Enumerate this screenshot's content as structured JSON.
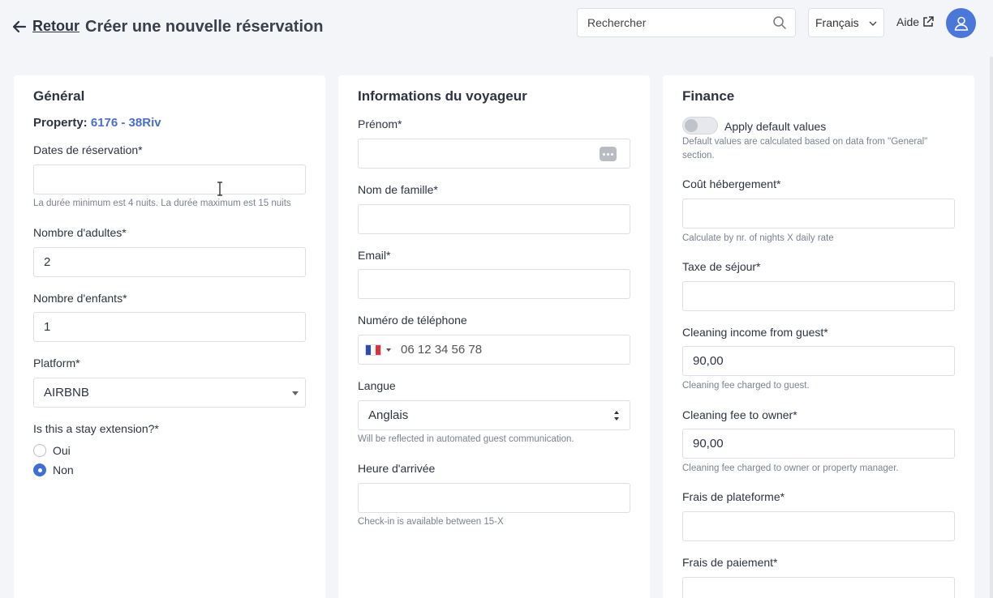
{
  "header": {
    "back_label": "Retour",
    "title": "Créer une nouvelle réservation",
    "search_placeholder": "Rechercher",
    "language": "Français",
    "help_label": "Aide"
  },
  "general": {
    "title": "Général",
    "property_key": "Property:",
    "property_value": "6176 - 38Riv",
    "dates_label": "Dates de réservation*",
    "dates_value": "",
    "dates_hint": "La durée minimum est 4 nuits. La durée maximum est 15 nuits",
    "adults_label": "Nombre d'adultes*",
    "adults_value": "2",
    "children_label": "Nombre d'enfants*",
    "children_value": "1",
    "platform_label": "Platform*",
    "platform_value": "AIRBNB",
    "extension_label": "Is this a stay extension?*",
    "options": [
      "Oui",
      "Non"
    ],
    "selected_option": "Non"
  },
  "traveler": {
    "title": "Informations du voyageur",
    "first_name_label": "Prénom*",
    "first_name_value": "",
    "last_name_label": "Nom de famille*",
    "last_name_value": "",
    "email_label": "Email*",
    "email_value": "",
    "phone_label": "Numéro de téléphone",
    "phone_placeholder": "06 12 34 56 78",
    "language_label": "Langue",
    "language_value": "Anglais",
    "language_hint": "Will be reflected in automated guest communication.",
    "arrival_label": "Heure d'arrivée",
    "arrival_value": "",
    "arrival_hint": "Check-in is available between 15-X"
  },
  "finance": {
    "title": "Finance",
    "toggle_label": "Apply default values",
    "toggle_on": false,
    "toggle_hint_1": "Default values are calculated based on data from \"General\"",
    "toggle_hint_2": "section.",
    "accommodation_label": "Coût hébergement*",
    "accommodation_value": "",
    "accommodation_hint": "Calculate by nr. of nights X daily rate",
    "tax_label": "Taxe de séjour*",
    "tax_value": "",
    "cleaning_income_label": "Cleaning income from guest*",
    "cleaning_income_value": "90,00",
    "cleaning_income_hint": "Cleaning fee charged to guest.",
    "cleaning_owner_label": "Cleaning fee to owner*",
    "cleaning_owner_value": "90,00",
    "cleaning_owner_hint": "Cleaning fee charged to owner or property manager.",
    "platform_fee_label": "Frais de plateforme*",
    "platform_fee_value": "",
    "payment_fee_label": "Frais de paiement*",
    "payment_fee_value": ""
  },
  "colors": {
    "accent": "#4a78d9",
    "link": "#4a6fc7",
    "background": "#f3f5f8"
  },
  "icons": {
    "back": "arrow-left-icon",
    "search": "search-icon",
    "help": "external-link-icon",
    "avatar": "user-icon"
  }
}
